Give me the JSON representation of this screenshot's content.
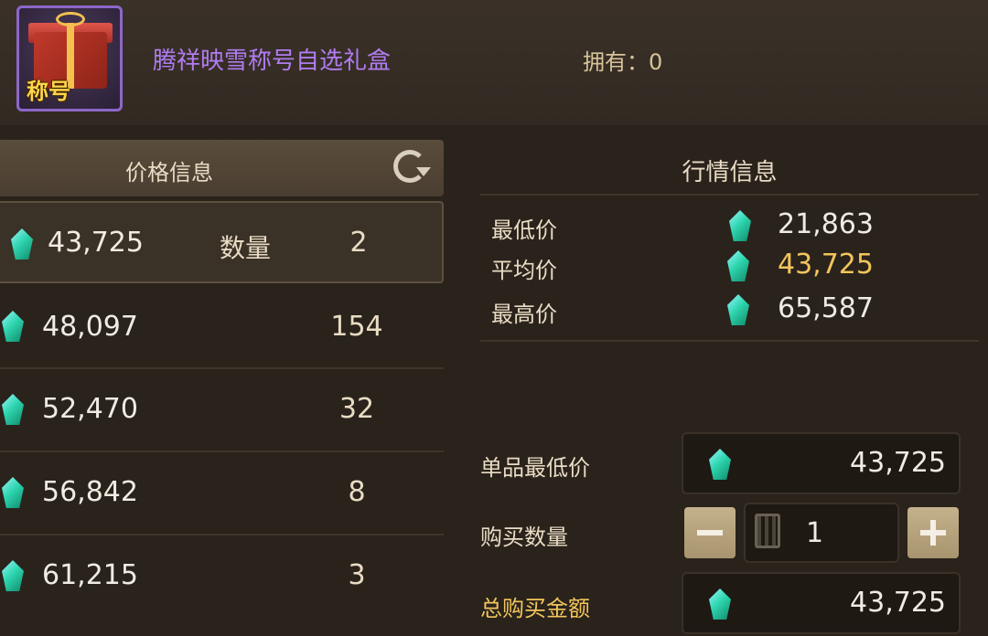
{
  "item": {
    "name": "腾祥映雪称号自选礼盒",
    "tag": "称号",
    "owned_label": "拥有：0"
  },
  "price_panel": {
    "title": "价格信息",
    "qty_label": "数量",
    "rows": [
      {
        "price": "43,725",
        "qty": "2",
        "selected": true
      },
      {
        "price": "48,097",
        "qty": "154"
      },
      {
        "price": "52,470",
        "qty": "32"
      },
      {
        "price": "56,842",
        "qty": "8"
      },
      {
        "price": "61,215",
        "qty": "3"
      }
    ]
  },
  "market_panel": {
    "title": "行情信息",
    "lowest_label": "最低价",
    "lowest_value": "21,863",
    "average_label": "平均价",
    "average_value": "43,725",
    "highest_label": "最高价",
    "highest_value": "65,587"
  },
  "purchase": {
    "unit_price_label": "单品最低价",
    "unit_price_value": "43,725",
    "quantity_label": "购买数量",
    "quantity_value": "1",
    "total_label": "总购买金额",
    "total_value": "43,725"
  },
  "colors": {
    "item_name": "#b07cf0",
    "highlight": "#f2c55c",
    "gem": "#2fd6b0"
  }
}
